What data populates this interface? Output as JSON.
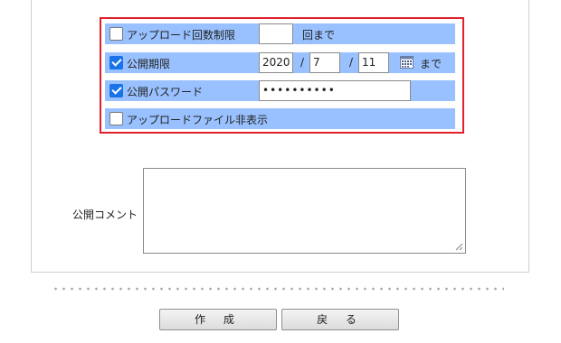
{
  "options": {
    "upload_limit": {
      "label": "アップロード回数制限",
      "checked": false,
      "count_value": "",
      "suffix": "回まで"
    },
    "expiry": {
      "label": "公開期限",
      "checked": true,
      "year": "2020",
      "sep1": "/",
      "month": "7",
      "sep2": "/",
      "day": "11",
      "calendar_icon": "calendar-icon",
      "suffix": "まで"
    },
    "password": {
      "label": "公開パスワード",
      "checked": true,
      "masked_value": "••••••••••"
    },
    "hide_file": {
      "label": "アップロードファイル非表示",
      "checked": false
    }
  },
  "comment": {
    "label": "公開コメント",
    "value": ""
  },
  "buttons": {
    "create": "作 成",
    "back": "戻 る"
  },
  "colors": {
    "highlight_border": "#e0202a",
    "row_background": "#99c1ff",
    "checkbox_checked": "#1a73e8"
  }
}
